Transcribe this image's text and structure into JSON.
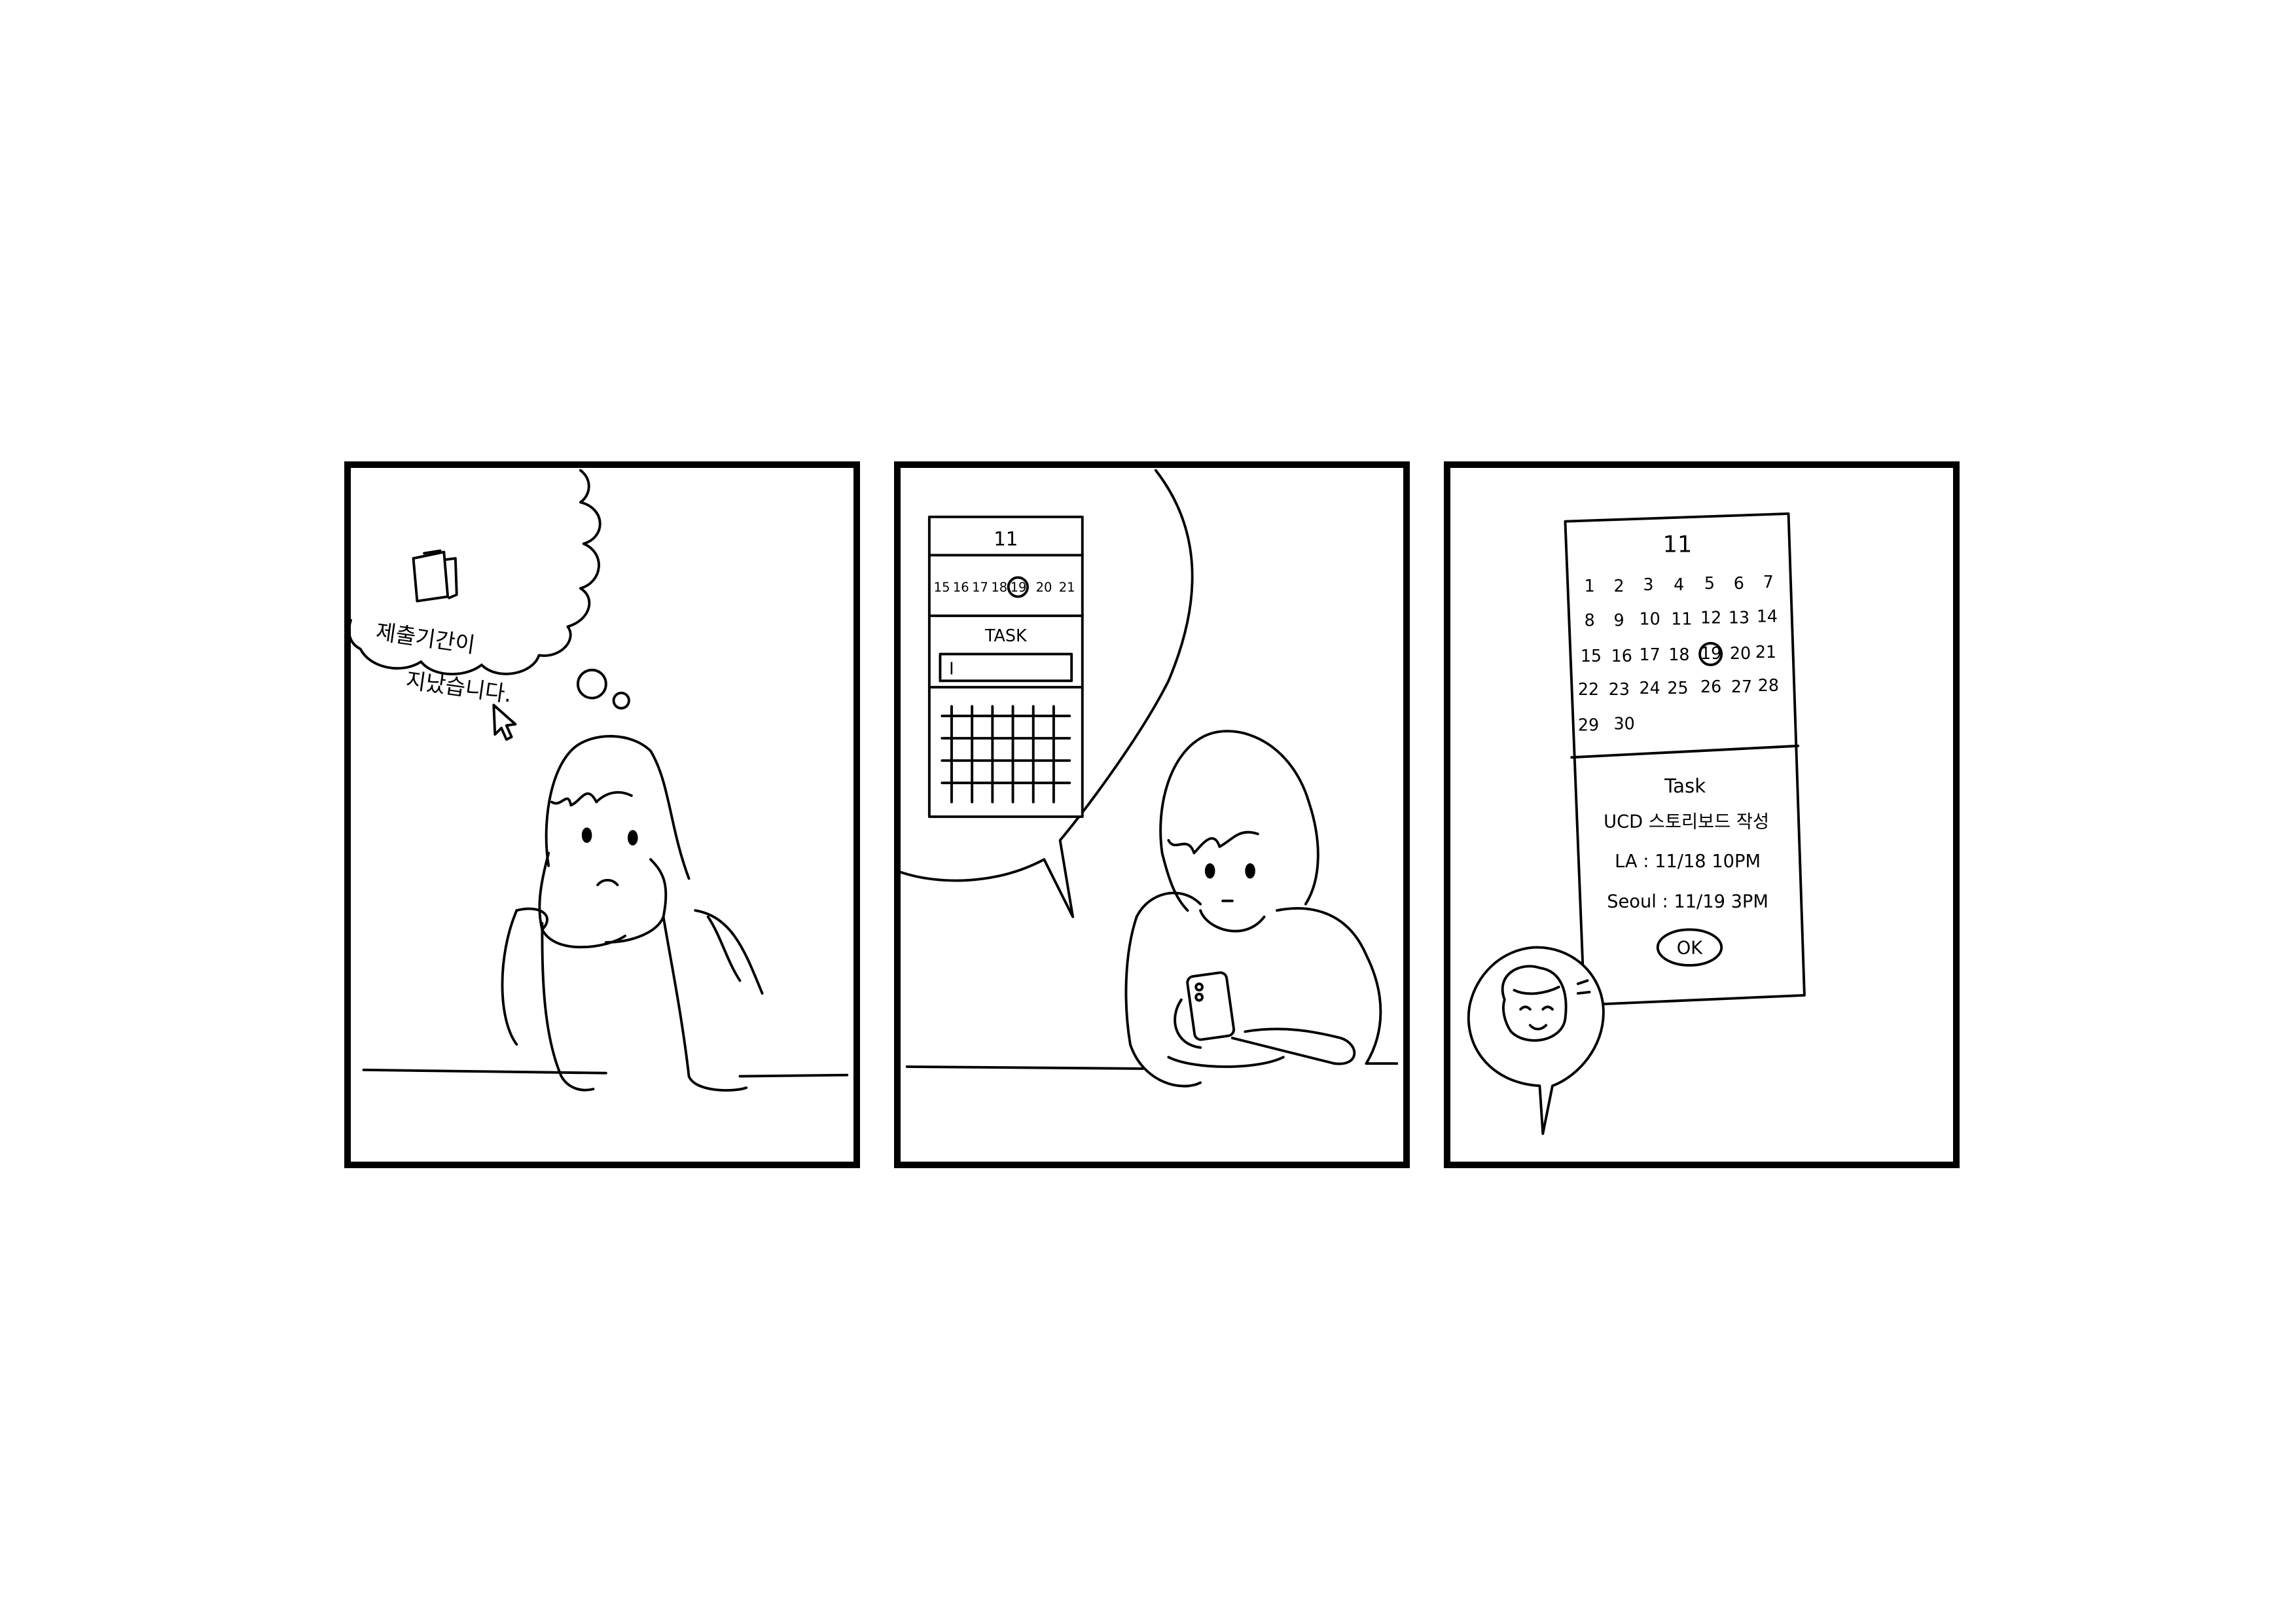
{
  "panel1": {
    "thought_line1": "제출기간이",
    "thought_line2": "지났습니다."
  },
  "panel2": {
    "month": "11",
    "week_days": [
      "15",
      "16",
      "17",
      "18",
      "19",
      "20",
      "21"
    ],
    "task_heading": "TASK",
    "task_input_value": "I"
  },
  "panel3": {
    "month": "11",
    "calendar_rows": [
      [
        "1",
        "2",
        "3",
        "4",
        "5",
        "6",
        "7"
      ],
      [
        "8",
        "9",
        "10",
        "11",
        "12",
        "13",
        "14"
      ],
      [
        "15",
        "16",
        "17",
        "18",
        "19",
        "20",
        "21"
      ],
      [
        "22",
        "23",
        "24",
        "25",
        "26",
        "27",
        "28"
      ],
      [
        "29",
        "30"
      ]
    ],
    "selected_day": "19",
    "task_heading": "Task",
    "task_title": "UCD 스토리보드 작성",
    "la_time": "LA : 11/18  10PM",
    "seoul_time": "Seoul : 11/19  3PM",
    "ok_label": "OK"
  },
  "icons": [
    "document-icon",
    "mouse-cursor-icon",
    "phone-icon",
    "calendar-grid-icon"
  ]
}
